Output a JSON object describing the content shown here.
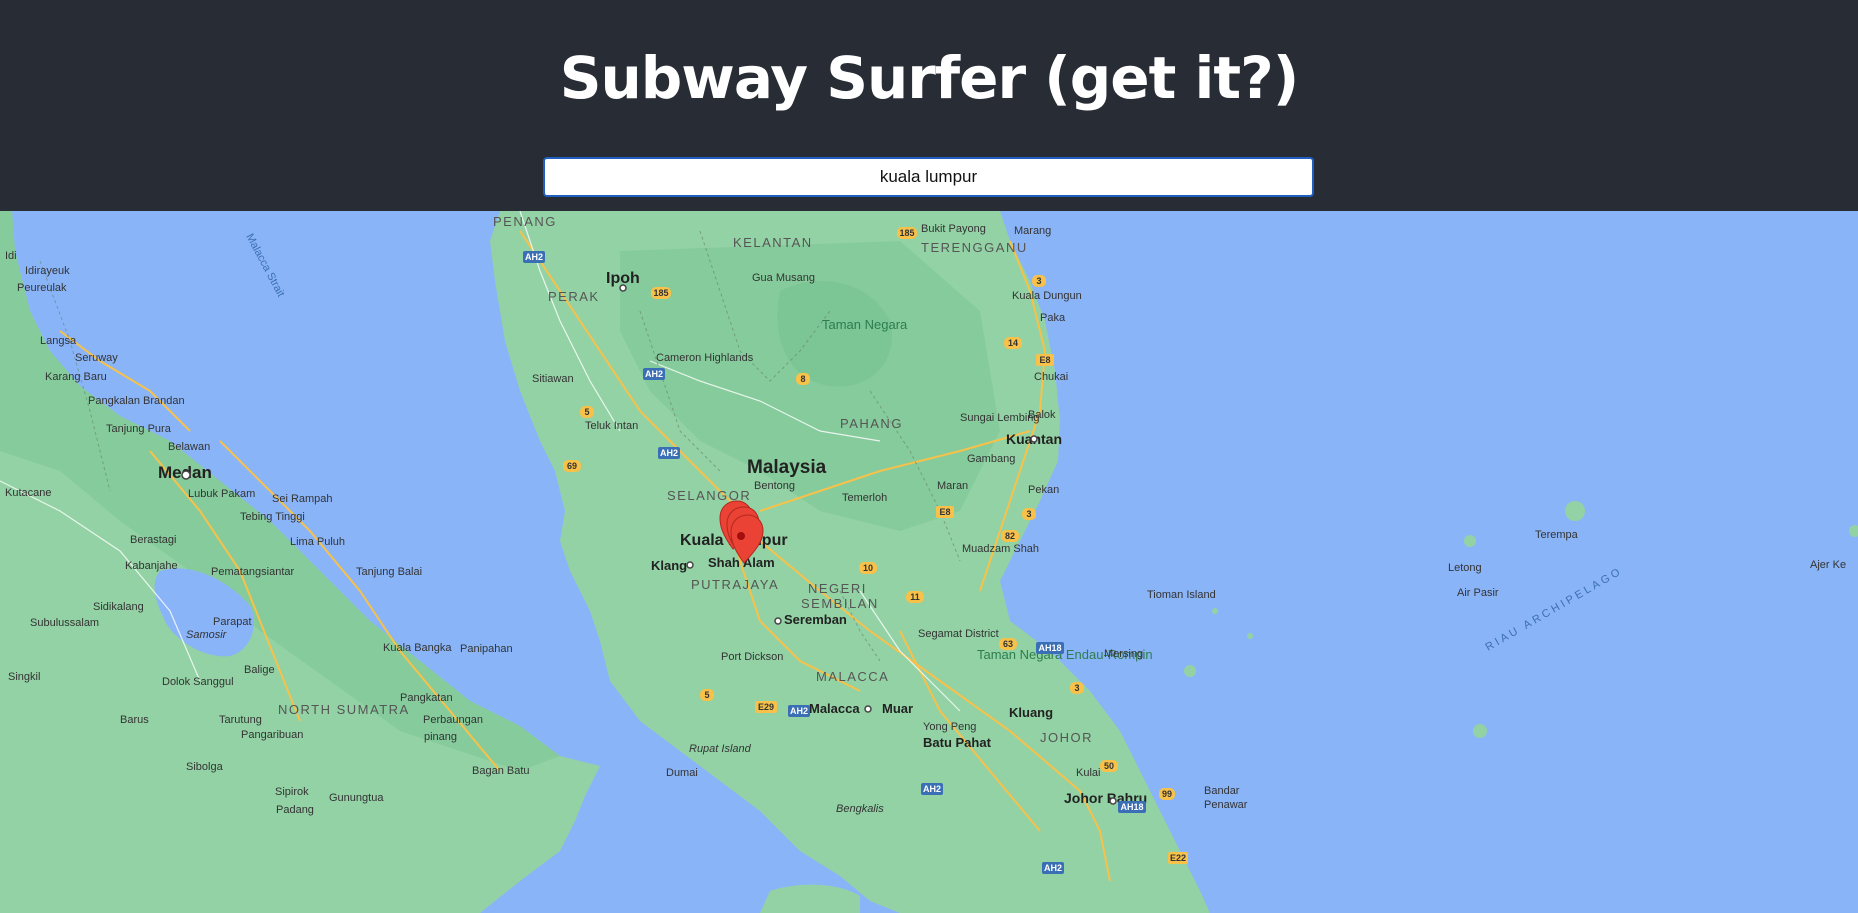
{
  "header": {
    "title": "Subway Surfer (get it?)"
  },
  "search": {
    "value": "kuala lumpur"
  },
  "map": {
    "colors": {
      "water": "#8ab4f8",
      "land": "#93d2a5",
      "land_dark": "#7cc595",
      "road": "#f7c14a",
      "marker": "#ea4335",
      "header_bg": "#282c34"
    },
    "markers_visible": 3,
    "labels": {
      "penang": "PENANG",
      "kelantan": "KELANTAN",
      "terengganu": "TERENGGANU",
      "bukit_payong": "Bukit Payong",
      "marang": "Marang",
      "malacca_strait": "Malacca Strait",
      "gua_musang": "Gua Musang",
      "kuala_dungun": "Kuala Dungun",
      "paka": "Paka",
      "perak": "PERAK",
      "ipoh": "Ipoh",
      "taman_negara": "Taman Negara",
      "idi": "Idi",
      "idirayeuk": "Idirayeuk",
      "peureulak": "Peureulak",
      "langsa": "Langsa",
      "seruway": "Seruway",
      "karang_baru": "Karang Baru",
      "cameron_highlands": "Cameron Highlands",
      "chukai": "Chukai",
      "sitiawan": "Sitiawan",
      "pangkalan_brandan": "Pangkalan Brandan",
      "tanjung_pura": "Tanjung Pura",
      "teluk_intan": "Teluk Intan",
      "pahang": "PAHANG",
      "sungai_lembing": "Sungai Lembing",
      "balok": "Balok",
      "kuantan": "Kuantan",
      "belawan": "Belawan",
      "medan": "Medan",
      "malaysia": "Malaysia",
      "gambang": "Gambang",
      "bentong": "Bentong",
      "maran": "Maran",
      "lubuk_pakam": "Lubuk Pakam",
      "sei_rampah": "Sei Rampah",
      "kutacane": "Kutacane",
      "selangor": "SELANGOR",
      "temerloh": "Temerloh",
      "pekan": "Pekan",
      "tebing_tinggi": "Tebing Tinggi",
      "kuala_lumpur": "Kuala Lumpur",
      "berastagi": "Berastagi",
      "lima_puluh": "Lima Puluh",
      "terempa": "Terempa",
      "muadzam_shah": "Muadzam Shah",
      "kabanjahe": "Kabanjahe",
      "klang": "Klang",
      "shah_alam": "Shah Alam",
      "letong": "Letong",
      "ajer_kuning": "Ajer Ke",
      "pematangsiantar": "Pematangsiantar",
      "tanjung_balai": "Tanjung Balai",
      "putrajaya": "PUTRAJAYA",
      "negeri_sembilan_1": "NEGERI",
      "negeri_sembilan_2": "SEMBILAN",
      "tioman_island": "Tioman Island",
      "air_pasir": "Air Pasir",
      "riau_archipelago": "RIAU ARCHIPELAGO",
      "sidikalang": "Sidikalang",
      "seremban": "Seremban",
      "parapat": "Parapat",
      "subulussalam": "Subulussalam",
      "samosir": "Samosir",
      "segamat_district": "Segamat District",
      "kuala_bangka": "Kuala Bangka",
      "panipahan": "Panipahan",
      "taman_negara_endau": "Taman Negara Endau-Rompin",
      "mersing": "Mersing",
      "port_dickson": "Port Dickson",
      "singkil": "Singkil",
      "dolok_sanggul": "Dolok Sanggul",
      "balige": "Balige",
      "malacca_state": "MALACCA",
      "pangkatan": "Pangkatan",
      "north_sumatra": "NORTH SUMATRA",
      "malacca_city": "Malacca",
      "muar": "Muar",
      "kluang": "Kluang",
      "barus": "Barus",
      "tarutung": "Tarutung",
      "perbaungan": "Perbaungan",
      "yong_peng": "Yong Peng",
      "johor": "JOHOR",
      "pangaribuan": "Pangaribuan",
      "pinang": "pinang",
      "batu_pahat": "Batu Pahat",
      "sibolga": "Sibolga",
      "rupat_island": "Rupat Island",
      "bagan_batu": "Bagan Batu",
      "dumai": "Dumai",
      "kulai": "Kulai",
      "bandar_penawar_1": "Bandar",
      "bandar_penawar_2": "Penawar",
      "sipirok": "Sipirok",
      "gunungtua": "Gunungtua",
      "johor_bahru": "Johor Bahru",
      "padang": "Padang",
      "bengkalis": "Bengkalis"
    },
    "shields": [
      "AH2",
      "185",
      "185",
      "3",
      "14",
      "E8",
      "AH2",
      "8",
      "5",
      "AH2",
      "69",
      "E8",
      "3",
      "82",
      "10",
      "11",
      "63",
      "AH18",
      "5",
      "E29",
      "AH2",
      "3",
      "50",
      "AH2",
      "AH18",
      "99",
      "AH2",
      "E22"
    ]
  }
}
